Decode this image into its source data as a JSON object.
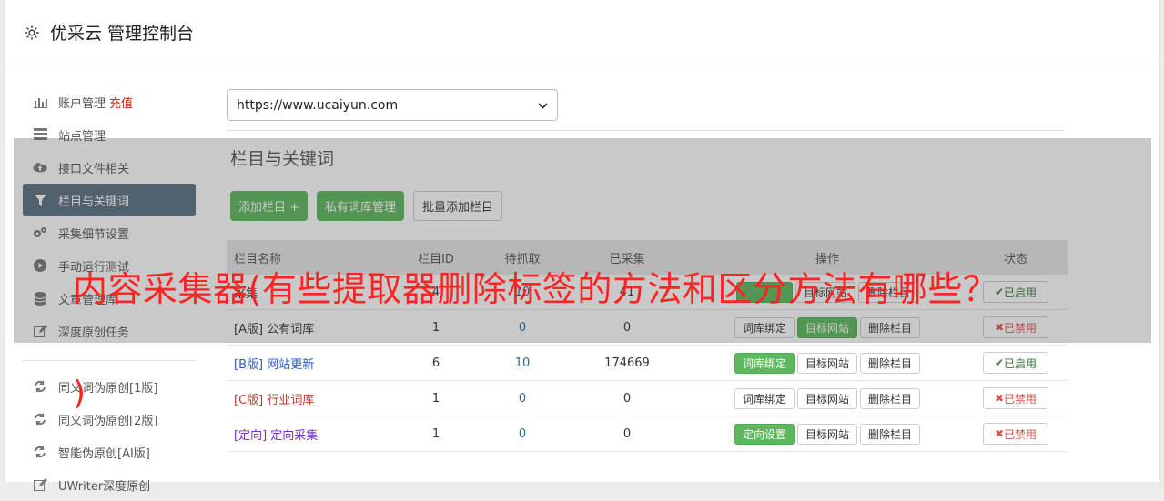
{
  "header": {
    "title": "优采云 管理控制台"
  },
  "sidebar": {
    "items": [
      {
        "label": "账户管理",
        "extra": "充值",
        "icon": "bar-chart-icon"
      },
      {
        "label": "站点管理",
        "icon": "server-icon"
      },
      {
        "label": "接口文件相关",
        "icon": "cloud-upload-icon"
      },
      {
        "label": "栏目与关键词",
        "icon": "filter-icon"
      },
      {
        "label": "采集细节设置",
        "icon": "cogs-icon"
      },
      {
        "label": "手动运行测试",
        "icon": "play-circle-icon"
      },
      {
        "label": "文章管理库",
        "icon": "database-icon"
      },
      {
        "label": "深度原创任务",
        "icon": "edit-icon"
      }
    ],
    "items2": [
      {
        "label": "同义词伪原创[1版]",
        "icon": "refresh-icon"
      },
      {
        "label": "同义词伪原创[2版]",
        "icon": "refresh-icon"
      },
      {
        "label": "智能伪原创[AI版]",
        "icon": "refresh-icon"
      },
      {
        "label": "UWriter深度原创",
        "icon": "edit-icon"
      }
    ]
  },
  "main": {
    "site_select": "https://www.ucaiyun.com",
    "section_title": "栏目与关键词",
    "buttons": {
      "add": "添加栏目 +",
      "private_lib": "私有词库管理",
      "batch_add": "批量添加栏目"
    }
  },
  "table": {
    "headers": [
      "栏目名称",
      "栏目ID",
      "待抓取",
      "已采集",
      "操作",
      "状态"
    ],
    "rows": [
      {
        "tag": "",
        "name": "采集",
        "id": "4",
        "pending": "10",
        "done": "41",
        "op1": "",
        "op2": "目标网站",
        "op3": "删除栏目",
        "state": "已启用"
      },
      {
        "tag": "[A版]",
        "name": "公有词库",
        "id": "1",
        "pending": "0",
        "done": "0",
        "op1": "词库绑定",
        "op2": "目标网站",
        "op3": "删除栏目",
        "state": "已禁用"
      },
      {
        "tag": "[B版]",
        "name": "网站更新",
        "id": "6",
        "pending": "10",
        "done": "174669",
        "op1": "词库绑定",
        "op2": "目标网站",
        "op3": "删除栏目",
        "state": "已启用"
      },
      {
        "tag": "[C版]",
        "name": "行业词库",
        "id": "1",
        "pending": "0",
        "done": "0",
        "op1": "词库绑定",
        "op2": "目标网站",
        "op3": "删除栏目",
        "state": "已禁用"
      },
      {
        "tag": "[定向]",
        "name": "定向采集",
        "id": "1",
        "pending": "0",
        "done": "0",
        "op1": "定向设置",
        "op2": "目标网站",
        "op3": "删除栏目",
        "state": "已禁用"
      }
    ]
  },
  "overlay": {
    "headline": "内容采集器(有些提取器删除标签的方法和区分方法有哪些？",
    "tail": ")"
  },
  "colors": {
    "green": "#5cb85c",
    "red": "#ff2323",
    "active": "#5b6f82"
  }
}
